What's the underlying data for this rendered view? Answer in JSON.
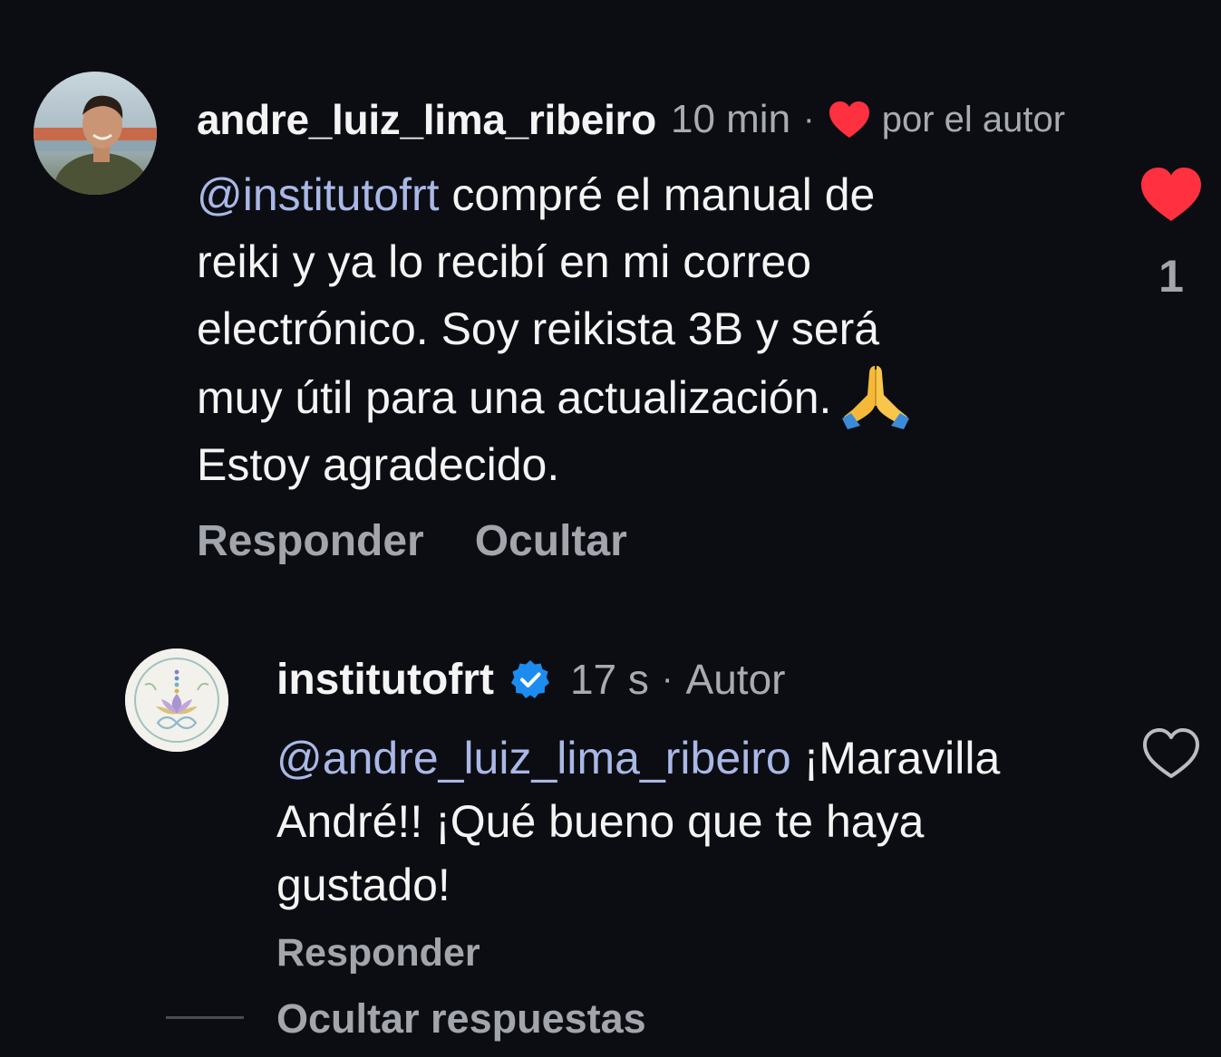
{
  "comment": {
    "username": "andre_luiz_lima_ribeiro",
    "time": "10 min",
    "separator": "·",
    "liked_by_author": "por el autor",
    "mention": "@institutofrt",
    "text_line1": "compré el manual de",
    "text_line2": "reiki y ya lo recibí en mi correo",
    "text_line3": "electrónico. Soy reikista 3B y será",
    "text_line4": "muy útil para una actualización.",
    "text_line5": "Estoy agradecido.",
    "emoji_icon": "folded-hands-icon",
    "reply_label": "Responder",
    "hide_label": "Ocultar",
    "like_count": "1",
    "like_state": "liked",
    "heart_color": "#ff3040"
  },
  "reply": {
    "username": "institutofrt",
    "verified_icon": "verified-badge-icon",
    "time": "17 s",
    "separator": "·",
    "author_label": "Autor",
    "mention": "@andre_luiz_lima_ribeiro",
    "text_line1": "¡Maravilla",
    "text_line2": "André!! ¡Qué bueno que te haya",
    "text_line3": "gustado!",
    "reply_label": "Responder",
    "like_state": "not-liked",
    "verified_color": "#1d8cf0"
  },
  "thread": {
    "hide_replies_label": "Ocultar respuestas"
  },
  "theme": {
    "background": "#0c0d12",
    "mention_color": "#a9b8e6",
    "muted_text": "#a2a5ac"
  }
}
